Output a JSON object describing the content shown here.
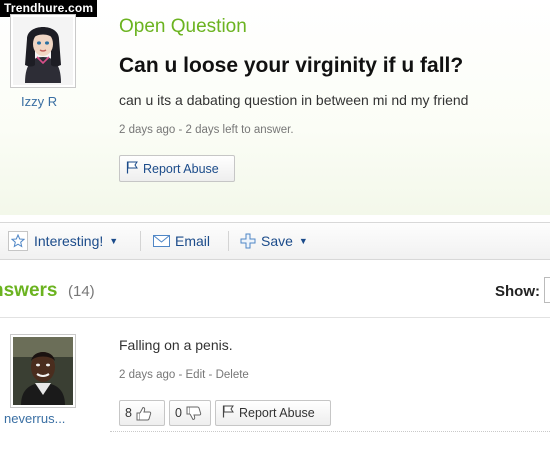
{
  "watermark": "Trendhure.com",
  "question": {
    "section_label": "Open Question",
    "title": "Can u loose your virginity if u fall?",
    "body": "can u its a dabating question in between mi nd my friend",
    "meta": "2 days ago - 2 days left to answer.",
    "asker": "Izzy R",
    "report_label": "Report Abuse"
  },
  "toolbar": {
    "interesting_label": "Interesting!",
    "email_label": "Email",
    "save_label": "Save"
  },
  "answers": {
    "heading": "nswers",
    "count": "(14)",
    "show_label": "Show:",
    "items": [
      {
        "user": "neverrus...",
        "body": "Falling on a penis.",
        "age": "2 days ago",
        "edit": "Edit",
        "delete": "Delete",
        "thumbs_up": "8",
        "thumbs_down": "0",
        "report_label": "Report Abuse"
      }
    ]
  },
  "colors": {
    "accent_green": "#6bb320",
    "link_blue": "#1b4b8a",
    "username_blue": "#3a6fa3"
  },
  "icons": [
    "star-icon",
    "chevron-down-icon",
    "envelope-icon",
    "plus-icon",
    "flag-icon",
    "thumbs-up-icon",
    "thumbs-down-icon"
  ]
}
